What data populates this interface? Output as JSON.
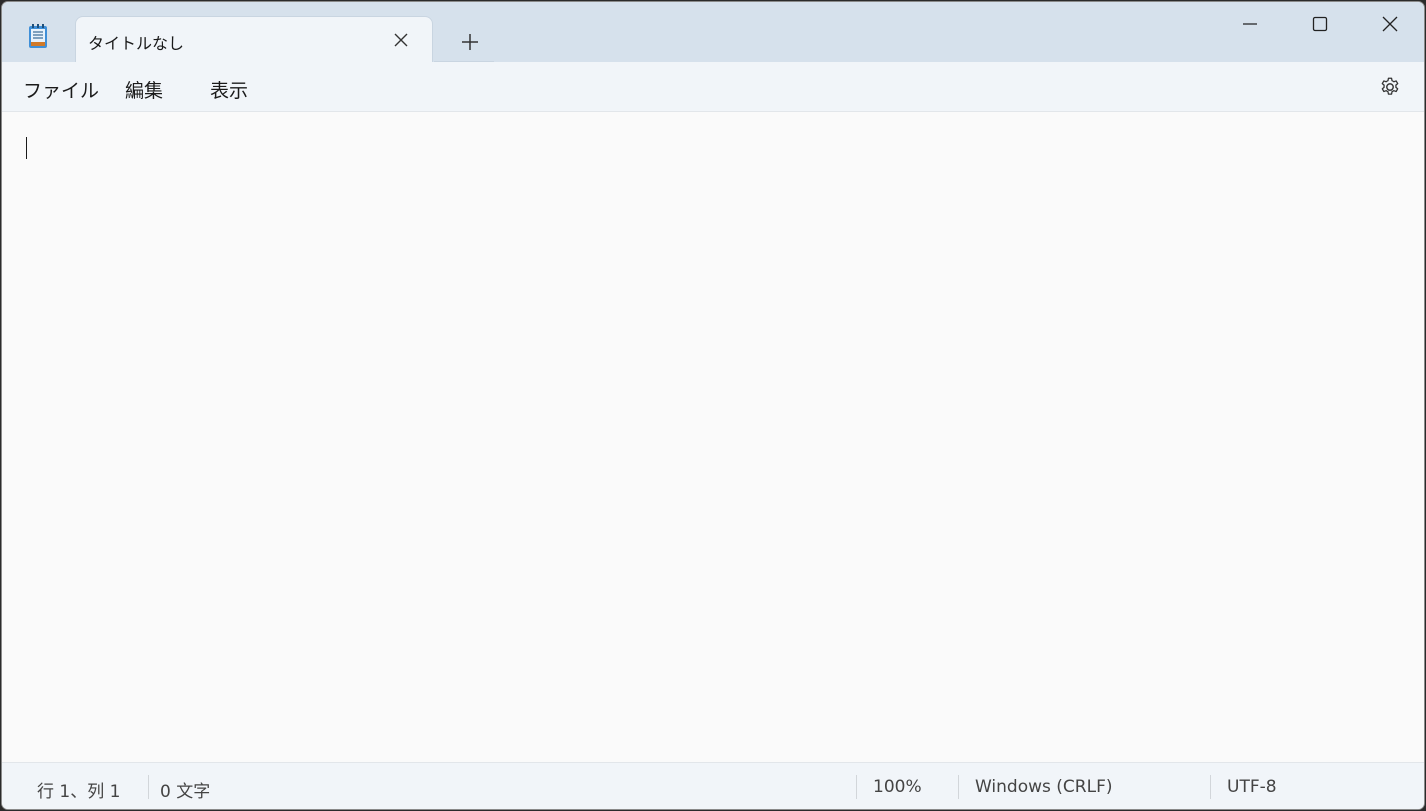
{
  "tab": {
    "title": "タイトルなし"
  },
  "menu": {
    "file": "ファイル",
    "edit": "編集",
    "view": "表示"
  },
  "status": {
    "position": "行 1、列 1",
    "chars": "0 文字",
    "zoom": "100%",
    "line_ending": "Windows (CRLF)",
    "encoding": "UTF-8"
  },
  "icons": {
    "app": "notepad-icon",
    "tab_close": "close-icon",
    "new_tab": "plus-icon",
    "minimize": "minimize-icon",
    "maximize": "maximize-icon",
    "close": "close-icon",
    "settings": "gear-icon"
  },
  "colors": {
    "titlebar": "#d6e1ec",
    "accent": "#1e7fd1"
  }
}
